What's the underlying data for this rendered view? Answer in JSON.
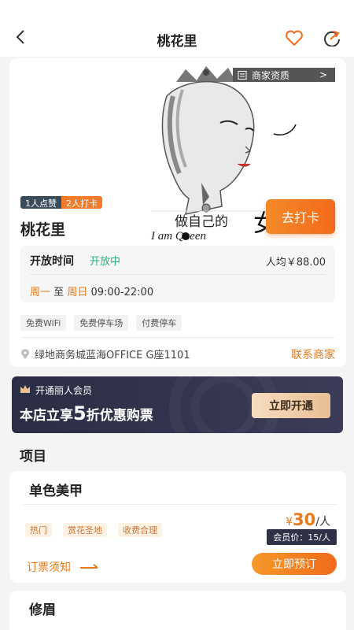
{
  "nav": {
    "title": "桃花里"
  },
  "banner": {
    "cert_label": "商家资质",
    "cert_arrow": ">",
    "art_text_cn": "做自己的",
    "art_text_big": "女王",
    "art_text_en": "I am Queen"
  },
  "shop": {
    "likes_badge": "1人点赞",
    "checkin_badge": "2人打卡",
    "name": "桃花里",
    "checkin_button": "去打卡",
    "hours_label": "开放时间",
    "open_status": "开放中",
    "avg_price": "人均￥88.00",
    "day_start": "周一",
    "day_to": "至",
    "day_end": "周日",
    "time_range": "09:00-22:00",
    "facilities": [
      "免费WiFi",
      "免费停车场",
      "付费停车"
    ],
    "address": "绿地商务城蓝海OFFICE G座1101",
    "contact": "联系商家"
  },
  "vip": {
    "header": "开通丽人会员",
    "line_prefix": "本店立享",
    "discount": "5",
    "line_suffix": "折优惠购票",
    "button": "立即开通"
  },
  "section": {
    "title": "项目"
  },
  "items": [
    {
      "name": "单色美甲",
      "tags": [
        "热门",
        "赏花圣地",
        "收费合理"
      ],
      "currency": "¥",
      "price": "30",
      "unit": "/人",
      "member_price": "会员价：15/人",
      "notice": "订票须知",
      "book": "立即预订"
    },
    {
      "name": "修眉"
    }
  ],
  "colors": {
    "accent": "#f26a1b",
    "open_green": "#2ab57d",
    "vip_dark": "#2b2d44"
  }
}
